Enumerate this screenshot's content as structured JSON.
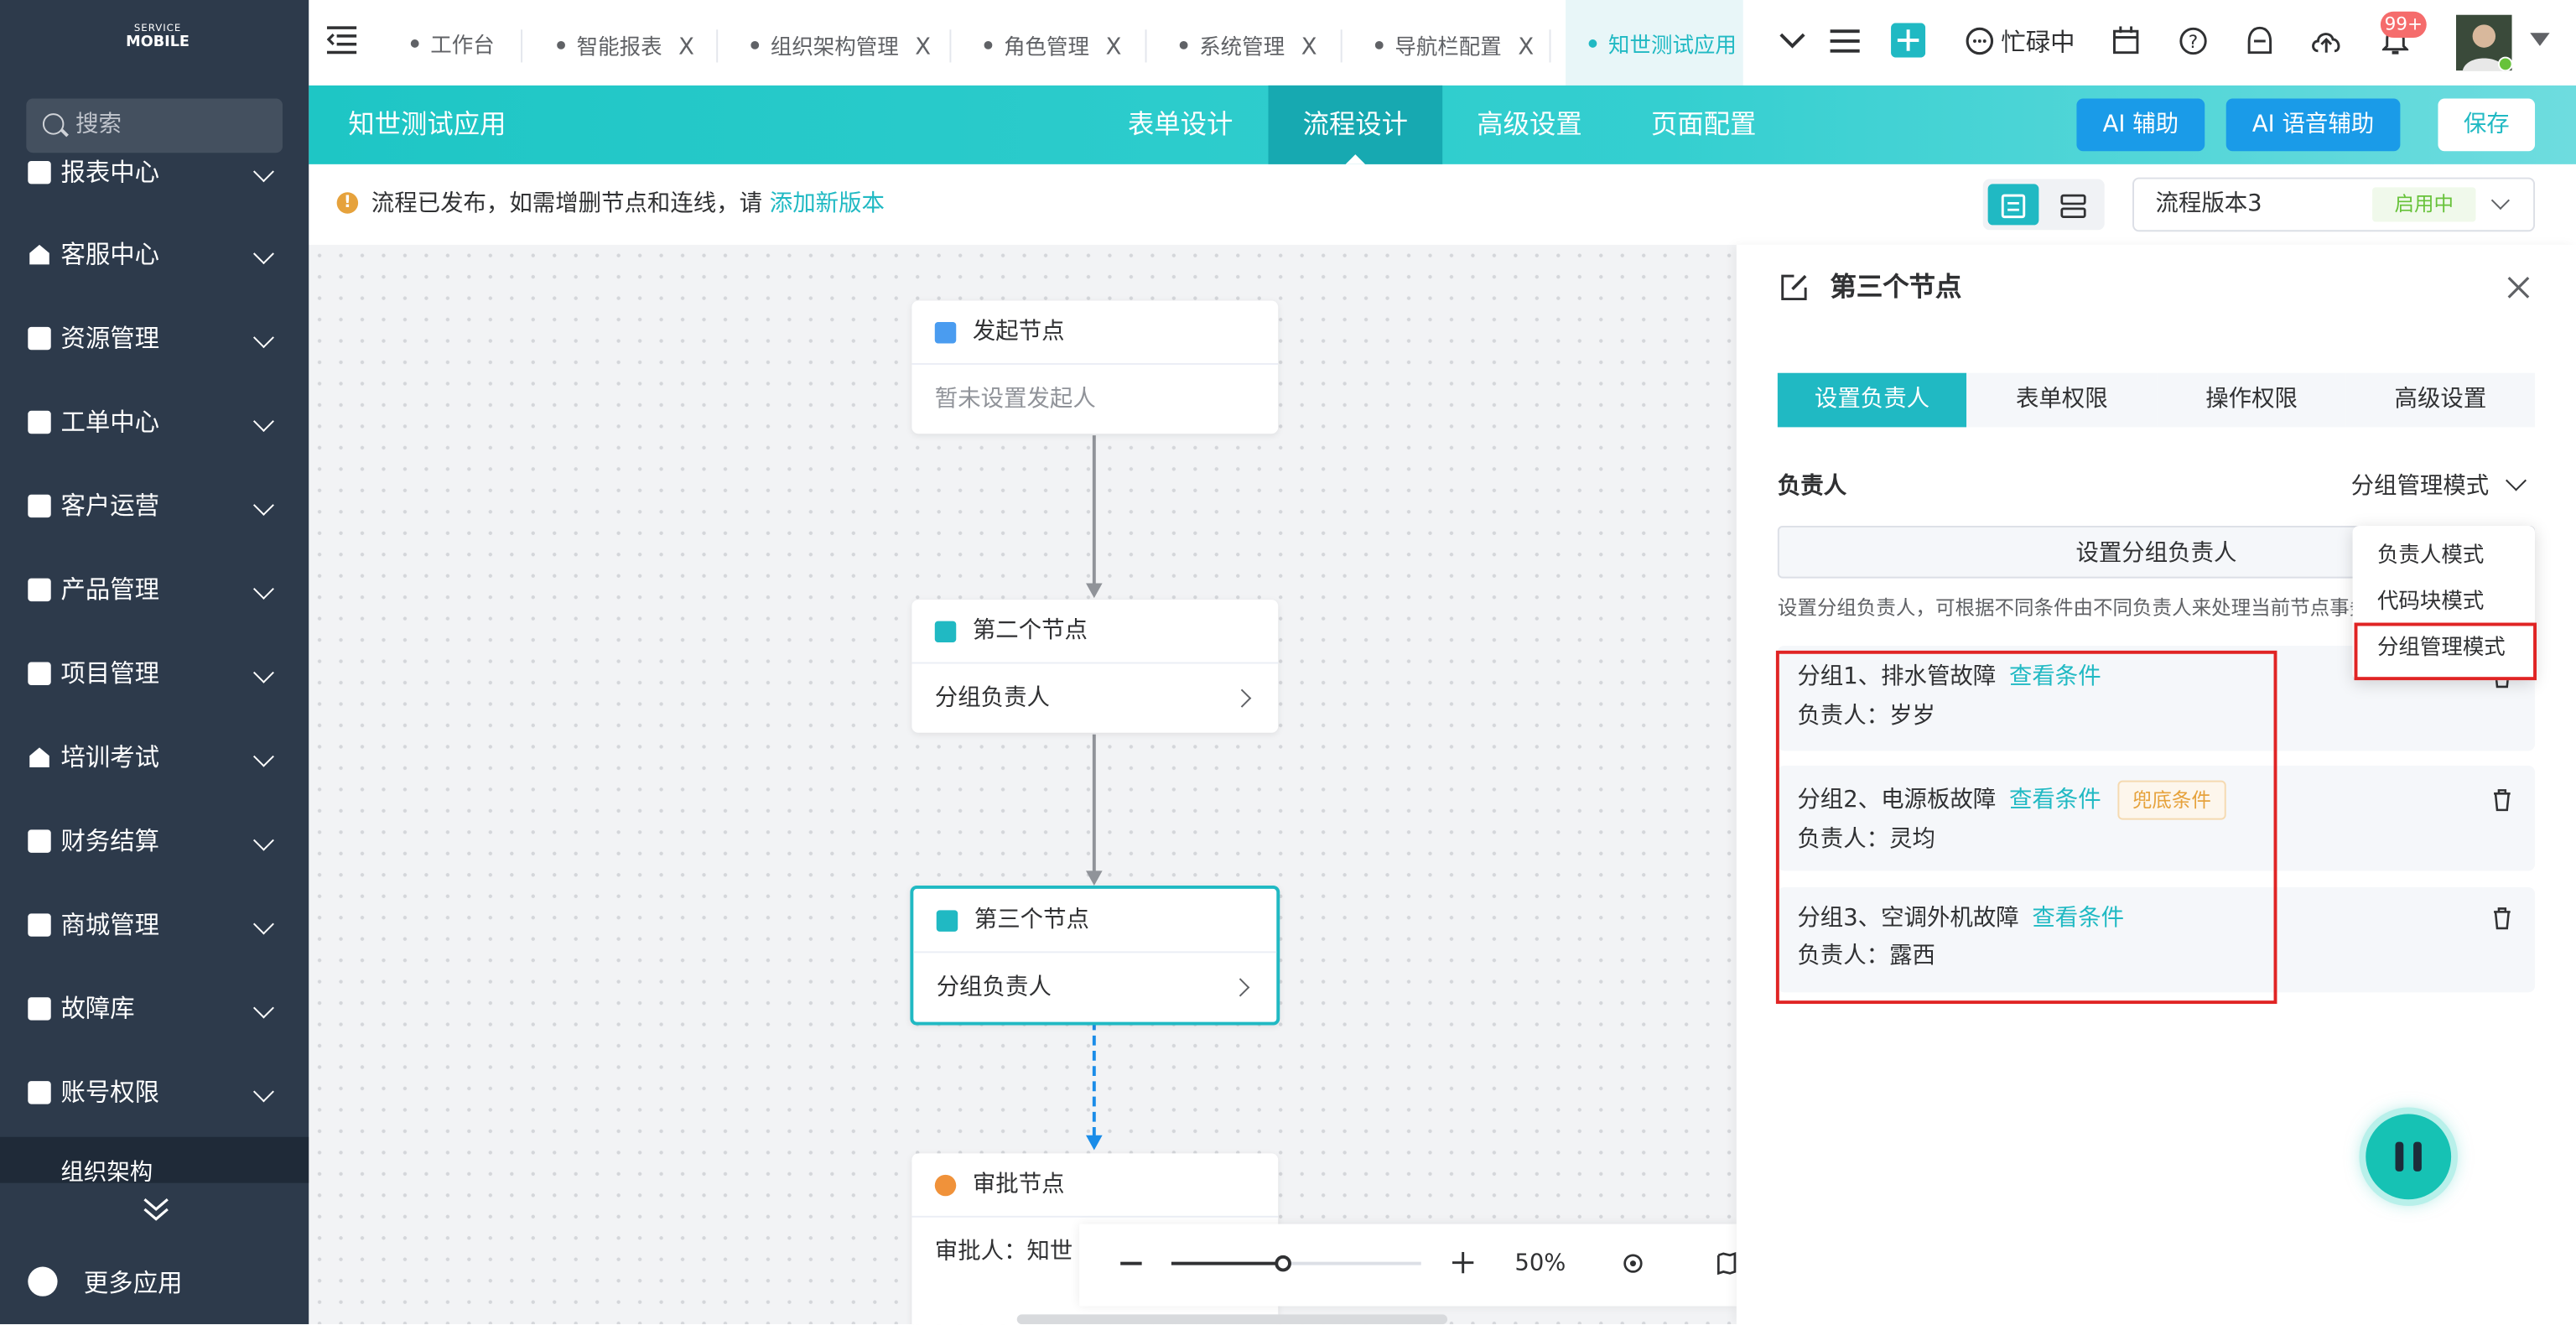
{
  "sidebar": {
    "logo": {
      "top": "SERVICE",
      "bottom": "MOBILE"
    },
    "search_placeholder": "搜索",
    "items": [
      {
        "label": "报表中心",
        "icon": "report-icon"
      },
      {
        "label": "客服中心",
        "icon": "home-icon"
      },
      {
        "label": "资源管理",
        "icon": "resource-icon"
      },
      {
        "label": "工单中心",
        "icon": "ticket-icon"
      },
      {
        "label": "客户运营",
        "icon": "customer-icon"
      },
      {
        "label": "产品管理",
        "icon": "product-icon"
      },
      {
        "label": "项目管理",
        "icon": "project-icon"
      },
      {
        "label": "培训考试",
        "icon": "training-icon"
      },
      {
        "label": "财务结算",
        "icon": "finance-icon"
      },
      {
        "label": "商城管理",
        "icon": "mall-icon"
      },
      {
        "label": "故障库",
        "icon": "fault-icon"
      },
      {
        "label": "账号权限",
        "icon": "account-icon"
      }
    ],
    "sub_item": "组织架构",
    "more_apps": "更多应用"
  },
  "tabs": [
    {
      "label": "工作台",
      "closable": false
    },
    {
      "label": "智能报表",
      "closable": true
    },
    {
      "label": "组织架构管理",
      "closable": true
    },
    {
      "label": "角色管理",
      "closable": true
    },
    {
      "label": "系统管理",
      "closable": true
    },
    {
      "label": "导航栏配置",
      "closable": true
    },
    {
      "label": "知世测试应用",
      "closable": false,
      "active": true
    }
  ],
  "toolbar": {
    "status": "忙碌中",
    "notification_count": "99+"
  },
  "header": {
    "app_title": "知世测试应用",
    "tabs": [
      "表单设计",
      "流程设计",
      "高级设置",
      "页面配置"
    ],
    "active_tab": "流程设计",
    "ai_assist": "AI 辅助",
    "ai_voice": "AI 语音辅助",
    "save": "保存"
  },
  "notice": {
    "text": "流程已发布，如需增删节点和连线，请",
    "link": "添加新版本"
  },
  "version": {
    "label": "流程版本3",
    "badge": "启用中"
  },
  "nodes": [
    {
      "title": "发起节点",
      "body": "暂未设置发起人",
      "icon_color": "#4a9cf0"
    },
    {
      "title": "第二个节点",
      "body": "分组负责人",
      "icon_color": "#20b9c3"
    },
    {
      "title": "第三个节点",
      "body": "分组负责人",
      "icon_color": "#20b9c3",
      "selected": true
    },
    {
      "title": "审批节点",
      "body": "审批人：知世",
      "icon_color": "#f0923a"
    }
  ],
  "zoom": {
    "level": "50%",
    "fraction": 0.45
  },
  "panel": {
    "title": "第三个节点",
    "tabs": [
      "设置负责人",
      "表单权限",
      "操作权限",
      "高级设置"
    ],
    "owner_label": "负责人",
    "mode": "分组管理模式",
    "set_group_button": "设置分组负责人",
    "description": "设置分组负责人，可根据不同条件由不同负责人来处理当前节点事务",
    "groups": [
      {
        "title": "分组1、排水管故障",
        "link": "查看条件",
        "owner": "负责人：岁岁",
        "badge": ""
      },
      {
        "title": "分组2、电源板故障",
        "link": "查看条件",
        "owner": "负责人：灵均",
        "badge": "兜底条件"
      },
      {
        "title": "分组3、空调外机故障",
        "link": "查看条件",
        "owner": "负责人：露西",
        "badge": ""
      }
    ],
    "mode_options": [
      "负责人模式",
      "代码块模式",
      "分组管理模式"
    ]
  },
  "colors": {
    "sidebar_bg": "#2d3a4b",
    "accent": "#20b9c3",
    "ai_button": "#1a9be8",
    "highlight": "#e02424"
  }
}
